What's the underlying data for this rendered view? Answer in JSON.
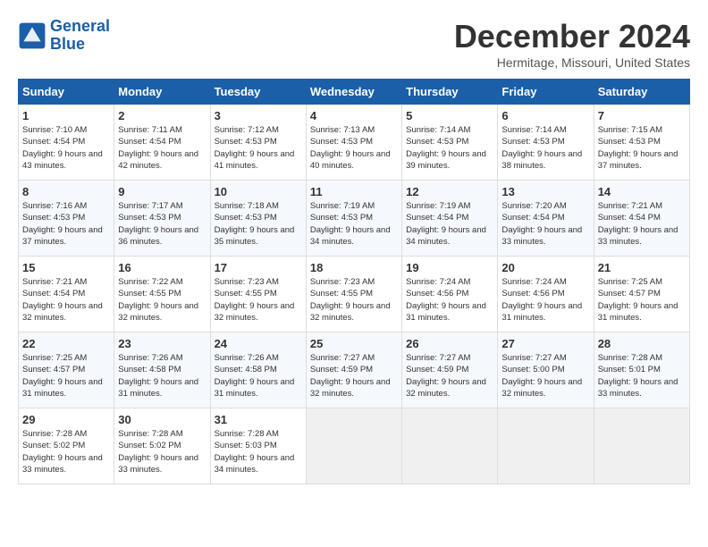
{
  "header": {
    "logo_general": "General",
    "logo_blue": "Blue",
    "month_title": "December 2024",
    "location": "Hermitage, Missouri, United States"
  },
  "calendar": {
    "days_of_week": [
      "Sunday",
      "Monday",
      "Tuesday",
      "Wednesday",
      "Thursday",
      "Friday",
      "Saturday"
    ],
    "weeks": [
      [
        null,
        null,
        null,
        null,
        null,
        null,
        null
      ]
    ],
    "cells": [
      {
        "day": "",
        "empty": true
      },
      {
        "day": "",
        "empty": true
      },
      {
        "day": "",
        "empty": true
      },
      {
        "day": "",
        "empty": true
      },
      {
        "day": "",
        "empty": true
      },
      {
        "day": "",
        "empty": true
      },
      {
        "day": "",
        "empty": true
      },
      {
        "day": "1",
        "sunrise": "7:10 AM",
        "sunset": "4:54 PM",
        "daylight": "9 hours and 43 minutes."
      },
      {
        "day": "2",
        "sunrise": "7:11 AM",
        "sunset": "4:54 PM",
        "daylight": "9 hours and 42 minutes."
      },
      {
        "day": "3",
        "sunrise": "7:12 AM",
        "sunset": "4:53 PM",
        "daylight": "9 hours and 41 minutes."
      },
      {
        "day": "4",
        "sunrise": "7:13 AM",
        "sunset": "4:53 PM",
        "daylight": "9 hours and 40 minutes."
      },
      {
        "day": "5",
        "sunrise": "7:14 AM",
        "sunset": "4:53 PM",
        "daylight": "9 hours and 39 minutes."
      },
      {
        "day": "6",
        "sunrise": "7:14 AM",
        "sunset": "4:53 PM",
        "daylight": "9 hours and 38 minutes."
      },
      {
        "day": "7",
        "sunrise": "7:15 AM",
        "sunset": "4:53 PM",
        "daylight": "9 hours and 37 minutes."
      },
      {
        "day": "8",
        "sunrise": "7:16 AM",
        "sunset": "4:53 PM",
        "daylight": "9 hours and 37 minutes."
      },
      {
        "day": "9",
        "sunrise": "7:17 AM",
        "sunset": "4:53 PM",
        "daylight": "9 hours and 36 minutes."
      },
      {
        "day": "10",
        "sunrise": "7:18 AM",
        "sunset": "4:53 PM",
        "daylight": "9 hours and 35 minutes."
      },
      {
        "day": "11",
        "sunrise": "7:19 AM",
        "sunset": "4:53 PM",
        "daylight": "9 hours and 34 minutes."
      },
      {
        "day": "12",
        "sunrise": "7:19 AM",
        "sunset": "4:54 PM",
        "daylight": "9 hours and 34 minutes."
      },
      {
        "day": "13",
        "sunrise": "7:20 AM",
        "sunset": "4:54 PM",
        "daylight": "9 hours and 33 minutes."
      },
      {
        "day": "14",
        "sunrise": "7:21 AM",
        "sunset": "4:54 PM",
        "daylight": "9 hours and 33 minutes."
      },
      {
        "day": "15",
        "sunrise": "7:21 AM",
        "sunset": "4:54 PM",
        "daylight": "9 hours and 32 minutes."
      },
      {
        "day": "16",
        "sunrise": "7:22 AM",
        "sunset": "4:55 PM",
        "daylight": "9 hours and 32 minutes."
      },
      {
        "day": "17",
        "sunrise": "7:23 AM",
        "sunset": "4:55 PM",
        "daylight": "9 hours and 32 minutes."
      },
      {
        "day": "18",
        "sunrise": "7:23 AM",
        "sunset": "4:55 PM",
        "daylight": "9 hours and 32 minutes."
      },
      {
        "day": "19",
        "sunrise": "7:24 AM",
        "sunset": "4:56 PM",
        "daylight": "9 hours and 31 minutes."
      },
      {
        "day": "20",
        "sunrise": "7:24 AM",
        "sunset": "4:56 PM",
        "daylight": "9 hours and 31 minutes."
      },
      {
        "day": "21",
        "sunrise": "7:25 AM",
        "sunset": "4:57 PM",
        "daylight": "9 hours and 31 minutes."
      },
      {
        "day": "22",
        "sunrise": "7:25 AM",
        "sunset": "4:57 PM",
        "daylight": "9 hours and 31 minutes."
      },
      {
        "day": "23",
        "sunrise": "7:26 AM",
        "sunset": "4:58 PM",
        "daylight": "9 hours and 31 minutes."
      },
      {
        "day": "24",
        "sunrise": "7:26 AM",
        "sunset": "4:58 PM",
        "daylight": "9 hours and 31 minutes."
      },
      {
        "day": "25",
        "sunrise": "7:27 AM",
        "sunset": "4:59 PM",
        "daylight": "9 hours and 32 minutes."
      },
      {
        "day": "26",
        "sunrise": "7:27 AM",
        "sunset": "4:59 PM",
        "daylight": "9 hours and 32 minutes."
      },
      {
        "day": "27",
        "sunrise": "7:27 AM",
        "sunset": "5:00 PM",
        "daylight": "9 hours and 32 minutes."
      },
      {
        "day": "28",
        "sunrise": "7:28 AM",
        "sunset": "5:01 PM",
        "daylight": "9 hours and 33 minutes."
      },
      {
        "day": "29",
        "sunrise": "7:28 AM",
        "sunset": "5:02 PM",
        "daylight": "9 hours and 33 minutes."
      },
      {
        "day": "30",
        "sunrise": "7:28 AM",
        "sunset": "5:02 PM",
        "daylight": "9 hours and 33 minutes."
      },
      {
        "day": "31",
        "sunrise": "7:28 AM",
        "sunset": "5:03 PM",
        "daylight": "9 hours and 34 minutes."
      },
      {
        "day": "",
        "empty": true
      },
      {
        "day": "",
        "empty": true
      },
      {
        "day": "",
        "empty": true
      },
      {
        "day": "",
        "empty": true
      }
    ]
  }
}
